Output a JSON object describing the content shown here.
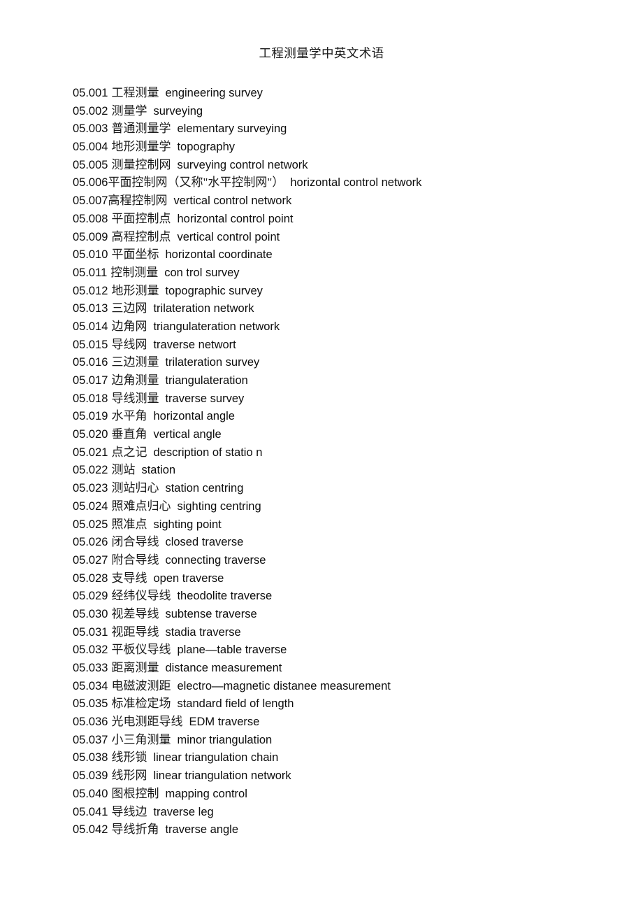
{
  "document": {
    "title": "工程测量学中英文术语",
    "page_background": "#ffffff",
    "text_color": "#0d0d0d"
  },
  "terms": [
    {
      "code": "05.001",
      "zh": "工程测量",
      "en": "engineering survey",
      "tight": false
    },
    {
      "code": "05.002",
      "zh": "测量学",
      "en": "surveying",
      "tight": false
    },
    {
      "code": "05.003",
      "zh": "普通测量学",
      "en": "elementary surveying",
      "tight": false
    },
    {
      "code": "05.004",
      "zh": "地形测量学",
      "en": "topography",
      "tight": false
    },
    {
      "code": "05.005",
      "zh": "测量控制网",
      "en": "surveying control network",
      "tight": false
    },
    {
      "code": "05.006",
      "zh": "平面控制网（又称\"水平控制网\"）",
      "en": "horizontal control network",
      "tight": true
    },
    {
      "code": "05.007",
      "zh": "高程控制网",
      "en": "vertical control network",
      "tight": true
    },
    {
      "code": "05.008",
      "zh": "平面控制点",
      "en": "horizontal control point",
      "tight": false
    },
    {
      "code": "05.009",
      "zh": "高程控制点",
      "en": "vertical control point",
      "tight": false
    },
    {
      "code": "05.010",
      "zh": "平面坐标",
      "en": "horizontal coordinate",
      "tight": false
    },
    {
      "code": "05.011",
      "zh": "控制测量",
      "en": "con trol survey",
      "tight": false
    },
    {
      "code": "05.012",
      "zh": "地形测量",
      "en": "topographic survey",
      "tight": false
    },
    {
      "code": "05.013",
      "zh": "三边网",
      "en": "trilateration network",
      "tight": false
    },
    {
      "code": "05.014",
      "zh": "边角网",
      "en": "triangulateration network",
      "tight": false
    },
    {
      "code": "05.015",
      "zh": "导线网",
      "en": "traverse networt",
      "tight": false
    },
    {
      "code": "05.016",
      "zh": "三边测量",
      "en": "trilateration survey",
      "tight": false
    },
    {
      "code": "05.017",
      "zh": "边角测量",
      "en": "triangulateration",
      "tight": false
    },
    {
      "code": "05.018",
      "zh": "导线测量",
      "en": "traverse survey",
      "tight": false
    },
    {
      "code": "05.019",
      "zh": "水平角",
      "en": "horizontal angle",
      "tight": false
    },
    {
      "code": "05.020",
      "zh": "垂直角",
      "en": "vertical angle",
      "tight": false
    },
    {
      "code": "05.021",
      "zh": "点之记",
      "en": "description of statio n",
      "tight": false
    },
    {
      "code": "05.022",
      "zh": "测站",
      "en": "station",
      "tight": false
    },
    {
      "code": "05.023",
      "zh": "测站归心",
      "en": "station centring",
      "tight": false
    },
    {
      "code": "05.024",
      "zh": "照难点归心",
      "en": "sighting centring",
      "tight": false
    },
    {
      "code": "05.025",
      "zh": "照准点",
      "en": "sighting point",
      "tight": false
    },
    {
      "code": "05.026",
      "zh": "闭合导线",
      "en": "closed traverse",
      "tight": false
    },
    {
      "code": "05.027",
      "zh": "附合导线",
      "en": "connecting traverse",
      "tight": false
    },
    {
      "code": "05.028",
      "zh": "支导线",
      "en": "open traverse",
      "tight": false
    },
    {
      "code": "05.029",
      "zh": "经纬仪导线",
      "en": "theodolite traverse",
      "tight": false
    },
    {
      "code": "05.030",
      "zh": "视差导线",
      "en": "subtense traverse",
      "tight": false
    },
    {
      "code": "05.031",
      "zh": "视距导线",
      "en": "stadia traverse",
      "tight": false
    },
    {
      "code": "05.032",
      "zh": "平板仪导线",
      "en": "plane—table traverse",
      "tight": false
    },
    {
      "code": "05.033",
      "zh": "距离测量",
      "en": "distance measurement",
      "tight": false
    },
    {
      "code": "05.034",
      "zh": "电磁波测距",
      "en": "electro—magnetic distanee measurement",
      "tight": false
    },
    {
      "code": "05.035",
      "zh": "标准检定场",
      "en": "standard field of length",
      "tight": false
    },
    {
      "code": "05.036",
      "zh": "光电测距导线",
      "en": "EDM traverse",
      "tight": false
    },
    {
      "code": "05.037",
      "zh": "小三角测量",
      "en": "minor triangulation",
      "tight": false
    },
    {
      "code": "05.038",
      "zh": "线形锁",
      "en": "linear triangulation chain",
      "tight": false
    },
    {
      "code": "05.039",
      "zh": "线形网",
      "en": "linear triangulation network",
      "tight": false
    },
    {
      "code": "05.040",
      "zh": "图根控制",
      "en": "mapping control",
      "tight": false
    },
    {
      "code": "05.041",
      "zh": "导线边",
      "en": "traverse leg",
      "tight": false
    },
    {
      "code": "05.042",
      "zh": "导线折角",
      "en": "traverse angle",
      "tight": false
    }
  ]
}
